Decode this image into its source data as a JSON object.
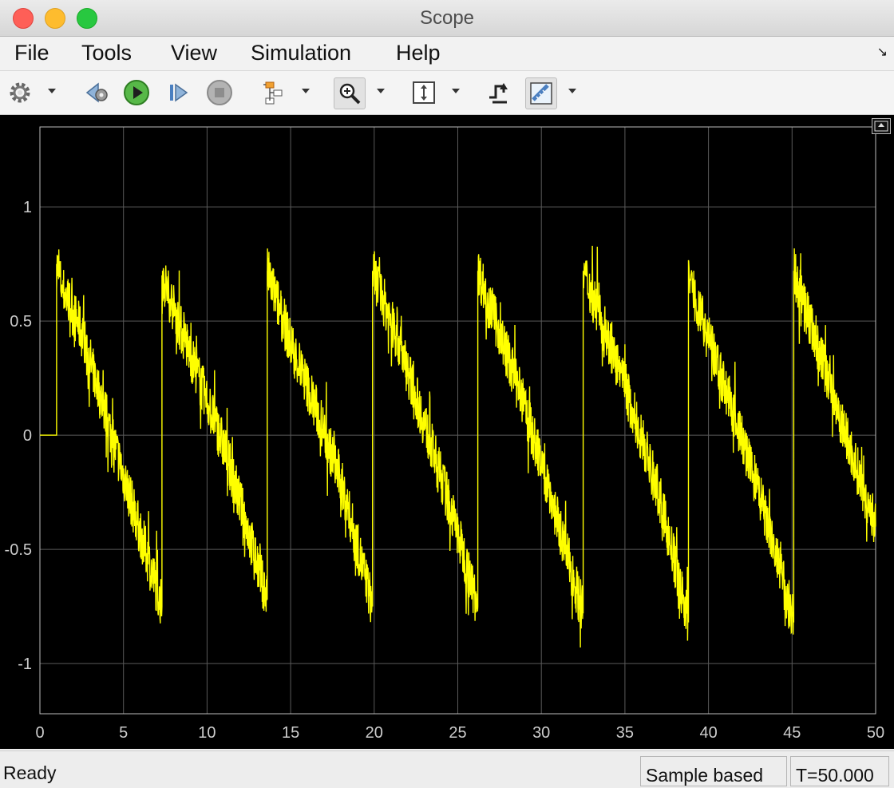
{
  "window": {
    "title": "Scope"
  },
  "menu": [
    "File",
    "Tools",
    "View",
    "Simulation",
    "Help"
  ],
  "toolbar": {
    "icons": [
      "settings-icon",
      "step-back-icon",
      "run-icon",
      "step-forward-icon",
      "stop-icon",
      "signal-selector-icon",
      "zoom-in-icon",
      "scale-axes-icon",
      "triggers-icon",
      "measurements-icon"
    ]
  },
  "status": {
    "text": "Ready",
    "mode": "Sample based",
    "time": "T=50.000"
  },
  "colors": {
    "signal": "#ffff00",
    "background": "#000000",
    "grid": "#5a5a5a",
    "axis_text": "#cccccc"
  },
  "chart_data": {
    "type": "line",
    "title": "",
    "xlabel": "",
    "ylabel": "",
    "xlim": [
      0,
      50
    ],
    "ylim": [
      -1.22,
      1.35
    ],
    "xticks": [
      0,
      5,
      10,
      15,
      20,
      25,
      30,
      35,
      40,
      45,
      50
    ],
    "yticks": [
      -1,
      -0.5,
      0,
      0.5,
      1
    ],
    "ytick_labels": [
      "-1",
      "-0.5",
      "0",
      "0.5",
      "1"
    ],
    "grid": true,
    "series": [
      {
        "description": "noisy sawtooth: zero until t=1, then period ~6.3 descending ramps from ~+0.75 to ~-0.75 with noise",
        "x": [
          0,
          1.0,
          1.0,
          1.3,
          2.5,
          3.5,
          4.5,
          5.5,
          6.5,
          7.3,
          7.3,
          8.5,
          10,
          11,
          12,
          13.6,
          13.6,
          15,
          16.5,
          18,
          19.9,
          19.9,
          21.5,
          23,
          24.5,
          26.2,
          26.2,
          27.5,
          29,
          30.5,
          32.5,
          32.5,
          34,
          35.5,
          37,
          38.8,
          38.8,
          40,
          41.5,
          43,
          45.1,
          45.1,
          46.5,
          48,
          50
        ],
        "y": [
          0,
          0,
          0.75,
          0.65,
          0.45,
          0.2,
          -0.05,
          -0.3,
          -0.55,
          -0.75,
          0.7,
          0.45,
          0.15,
          -0.05,
          -0.3,
          -0.72,
          0.72,
          0.4,
          0.12,
          -0.2,
          -0.75,
          0.72,
          0.4,
          0.05,
          -0.3,
          -0.75,
          0.72,
          0.45,
          0.12,
          -0.25,
          -0.78,
          0.72,
          0.42,
          0.1,
          -0.25,
          -0.82,
          0.7,
          0.42,
          0.1,
          -0.25,
          -0.82,
          0.72,
          0.4,
          0.05,
          -0.4
        ]
      }
    ]
  }
}
